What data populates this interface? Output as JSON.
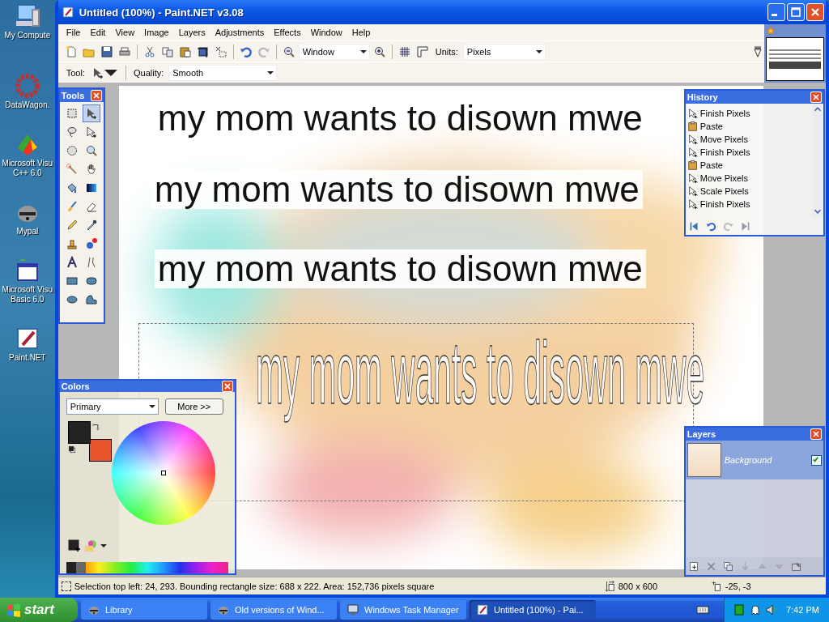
{
  "desktop_icons": [
    {
      "label": "My Compute"
    },
    {
      "label": "DataWagon."
    },
    {
      "label": "Microsoft Visu\nC++ 6.0"
    },
    {
      "label": "Mypal"
    },
    {
      "label": "Microsoft Visu\nBasic 6.0"
    },
    {
      "label": "Paint.NET"
    }
  ],
  "window": {
    "title": "Untitled (100%) - Paint.NET v3.08"
  },
  "menu": [
    "File",
    "Edit",
    "View",
    "Image",
    "Layers",
    "Adjustments",
    "Effects",
    "Window",
    "Help"
  ],
  "toolbar": {
    "zoom": "Window",
    "units_label": "Units:",
    "units": "Pixels",
    "tool_label": "Tool:",
    "quality_label": "Quality:",
    "quality": "Smooth"
  },
  "canvas": {
    "texts": [
      {
        "kind": "plain",
        "text": "my mom wants to disown mwe"
      },
      {
        "kind": "band",
        "text": "my mom wants to disown mwe"
      },
      {
        "kind": "band",
        "text": "my mom wants to disown mwe"
      },
      {
        "kind": "outline",
        "text": "my mom wants to disown mwe"
      }
    ]
  },
  "tools_panel": {
    "title": "Tools",
    "tools": [
      {
        "selected": false
      },
      {
        "selected": true
      },
      {
        "selected": false
      },
      {
        "selected": false
      },
      {
        "selected": false
      },
      {
        "selected": false
      },
      {
        "selected": false
      },
      {
        "selected": false
      },
      {
        "selected": false
      },
      {
        "selected": false
      },
      {
        "selected": false
      },
      {
        "selected": false
      },
      {
        "selected": false
      },
      {
        "selected": false
      },
      {
        "selected": false
      },
      {
        "selected": false
      },
      {
        "selected": false
      },
      {
        "selected": false
      },
      {
        "selected": false
      },
      {
        "selected": false
      },
      {
        "selected": false
      },
      {
        "selected": false
      }
    ]
  },
  "history_panel": {
    "title": "History",
    "items": [
      {
        "kind": "move",
        "label": "Finish Pixels"
      },
      {
        "kind": "paste",
        "label": "Paste"
      },
      {
        "kind": "move",
        "label": "Move Pixels"
      },
      {
        "kind": "move",
        "label": "Finish Pixels"
      },
      {
        "kind": "paste",
        "label": "Paste"
      },
      {
        "kind": "move",
        "label": "Move Pixels"
      },
      {
        "kind": "move",
        "label": "Scale Pixels"
      },
      {
        "kind": "move",
        "label": "Finish Pixels"
      }
    ]
  },
  "colors_panel": {
    "title": "Colors",
    "mode": "Primary",
    "more": "More >>",
    "primary": {
      "color": "#222222"
    },
    "secondary": {
      "color": "#e8552a"
    }
  },
  "layers_panel": {
    "title": "Layers",
    "layers": [
      {
        "name": "Background",
        "selected": true,
        "visible": true
      }
    ]
  },
  "status_bar": {
    "selection": "Selection top left: 24, 293. Bounding rectangle size: 688 x 222. Area: 152,736 pixels square",
    "size": "800 x 600",
    "cursor": "-25, -3"
  },
  "taskbar": {
    "start": "start",
    "tasks": [
      {
        "label": "Library",
        "selected": false
      },
      {
        "label": "Old versions of Wind...",
        "selected": false
      },
      {
        "label": "Windows Task Manager",
        "selected": false
      },
      {
        "label": "Untitled (100%) - Pai...",
        "selected": true
      }
    ],
    "clock": "7:42 PM"
  }
}
